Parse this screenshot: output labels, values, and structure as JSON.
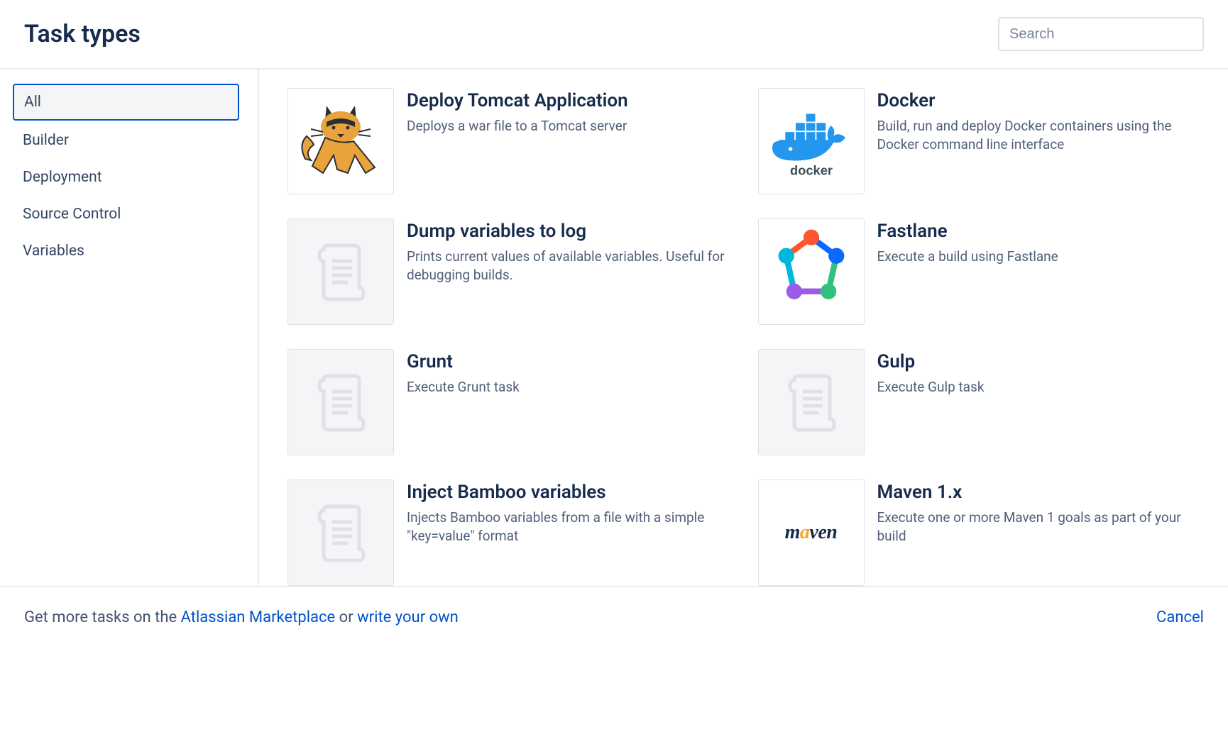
{
  "header": {
    "title": "Task types",
    "search_placeholder": "Search"
  },
  "sidebar": {
    "items": [
      {
        "label": "All",
        "selected": true
      },
      {
        "label": "Builder",
        "selected": false
      },
      {
        "label": "Deployment",
        "selected": false
      },
      {
        "label": "Source Control",
        "selected": false
      },
      {
        "label": "Variables",
        "selected": false
      }
    ]
  },
  "tasks": [
    {
      "title": "Deploy Tomcat Application",
      "description": "Deploys a war file to a Tomcat server",
      "icon": "tomcat"
    },
    {
      "title": "Docker",
      "description": "Build, run and deploy Docker containers using the Docker command line interface",
      "icon": "docker"
    },
    {
      "title": "Dump variables to log",
      "description": "Prints current values of available variables. Useful for debugging builds.",
      "icon": "placeholder"
    },
    {
      "title": "Fastlane",
      "description": "Execute a build using Fastlane",
      "icon": "fastlane"
    },
    {
      "title": "Grunt",
      "description": "Execute Grunt task",
      "icon": "placeholder"
    },
    {
      "title": "Gulp",
      "description": "Execute Gulp task",
      "icon": "placeholder"
    },
    {
      "title": "Inject Bamboo variables",
      "description": "Injects Bamboo variables from a file with a simple \"key=value\" format",
      "icon": "placeholder"
    },
    {
      "title": "Maven 1.x",
      "description": "Execute one or more Maven 1 goals as part of your build",
      "icon": "maven"
    }
  ],
  "footer": {
    "prefix": "Get more tasks on the ",
    "marketplace": "Atlassian Marketplace",
    "mid": " or ",
    "write_own": "write your own",
    "cancel": "Cancel"
  }
}
